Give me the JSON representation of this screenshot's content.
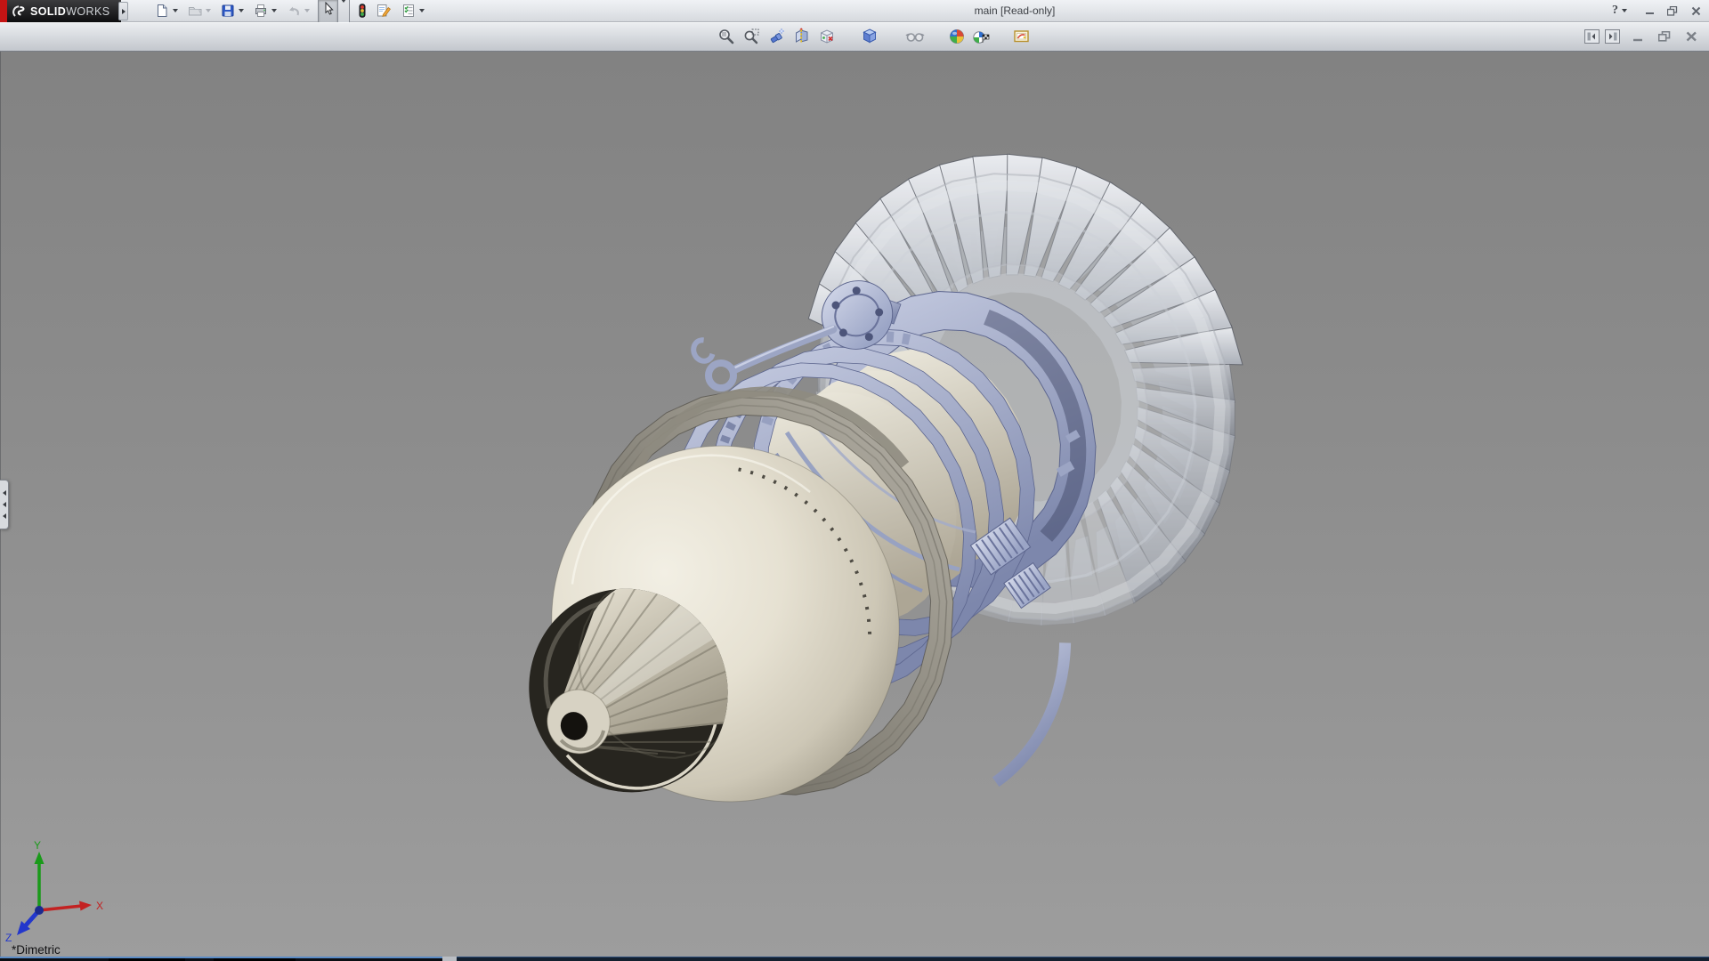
{
  "window": {
    "brand_accent_color": "#c41414",
    "brand_bold": "SOLID",
    "brand_light": "WORKS",
    "title": "main [Read-only]",
    "help_label": "?"
  },
  "main_toolbar": {
    "items": [
      {
        "name": "new-document",
        "dropdown": true,
        "enabled": true
      },
      {
        "name": "open",
        "dropdown": true,
        "enabled": false
      },
      {
        "name": "save",
        "dropdown": true,
        "enabled": true
      },
      {
        "name": "print",
        "dropdown": true,
        "enabled": true
      },
      {
        "name": "undo",
        "dropdown": true,
        "enabled": false
      },
      {
        "name": "select",
        "dropdown": true,
        "enabled": true,
        "active": true
      },
      {
        "name": "selection-stoplight",
        "dropdown": false,
        "enabled": true
      },
      {
        "name": "edit-sheet",
        "dropdown": false,
        "enabled": true
      },
      {
        "name": "options-checklist",
        "dropdown": true,
        "enabled": true
      }
    ]
  },
  "headsup_toolbar": {
    "items": [
      "zoom-to-fit",
      "zoom-to-area",
      "previous-view",
      "section-view",
      "dynamic-annotation-views",
      "view-orientation",
      "hide-show-items",
      "apply-scene",
      "view-settings",
      "edit-appearance"
    ]
  },
  "document_window_controls": {
    "pane_buttons": [
      "dock-pane-left",
      "dock-pane-right"
    ],
    "buttons": [
      "minimize",
      "restore",
      "close"
    ]
  },
  "titlebar_window_controls": [
    "minimize",
    "restore",
    "close"
  ],
  "viewport": {
    "orientation_label": "*Dimetric",
    "triad": {
      "x": "X",
      "y": "Y",
      "z": "Z",
      "x_color": "#c32222",
      "y_color": "#1a9a1a",
      "z_color": "#2337cc"
    },
    "background_top": "#828282",
    "background_bottom": "#9d9d9d",
    "model_colors": {
      "cream_light": "#f2efe4",
      "cream": "#ddd8c7",
      "cream_dark": "#9a9486",
      "lavender_light": "#d4d9ea",
      "lavender": "#a7b0cd",
      "lavender_dark": "#646e97",
      "gray_ring_light": "#b7b3a8",
      "gray_ring_dark": "#615e55",
      "blade_light": "#f0f2f6",
      "blade_mid": "#b4b9c2",
      "blade_dark": "#878c96"
    }
  }
}
